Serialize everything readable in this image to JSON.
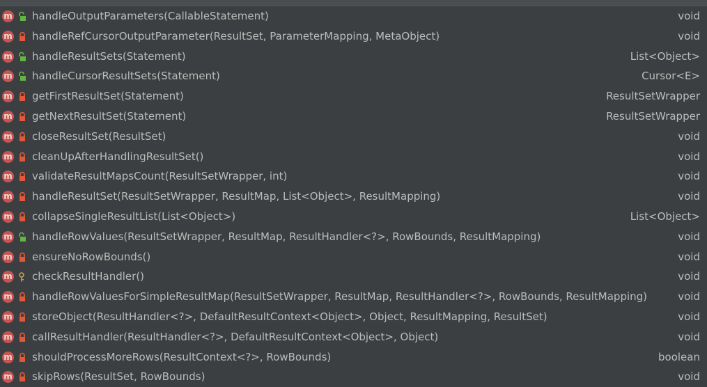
{
  "members": [
    {
      "signature": "handleOutputParameters(CallableStatement)",
      "return_type": "void",
      "visibility": "public-icon"
    },
    {
      "signature": "handleRefCursorOutputParameter(ResultSet, ParameterMapping, MetaObject)",
      "return_type": "void",
      "visibility": "private-icon"
    },
    {
      "signature": "handleResultSets(Statement)",
      "return_type": "List<Object>",
      "visibility": "public-icon"
    },
    {
      "signature": "handleCursorResultSets(Statement)",
      "return_type": "Cursor<E>",
      "visibility": "public-icon"
    },
    {
      "signature": "getFirstResultSet(Statement)",
      "return_type": "ResultSetWrapper",
      "visibility": "private-icon"
    },
    {
      "signature": "getNextResultSet(Statement)",
      "return_type": "ResultSetWrapper",
      "visibility": "private-icon"
    },
    {
      "signature": "closeResultSet(ResultSet)",
      "return_type": "void",
      "visibility": "private-icon"
    },
    {
      "signature": "cleanUpAfterHandlingResultSet()",
      "return_type": "void",
      "visibility": "private-icon"
    },
    {
      "signature": "validateResultMapsCount(ResultSetWrapper, int)",
      "return_type": "void",
      "visibility": "private-icon"
    },
    {
      "signature": "handleResultSet(ResultSetWrapper, ResultMap, List<Object>, ResultMapping)",
      "return_type": "void",
      "visibility": "private-icon"
    },
    {
      "signature": "collapseSingleResultList(List<Object>)",
      "return_type": "List<Object>",
      "visibility": "private-icon"
    },
    {
      "signature": "handleRowValues(ResultSetWrapper, ResultMap, ResultHandler<?>, RowBounds, ResultMapping)",
      "return_type": "void",
      "visibility": "public-icon"
    },
    {
      "signature": "ensureNoRowBounds()",
      "return_type": "void",
      "visibility": "private-icon"
    },
    {
      "signature": "checkResultHandler()",
      "return_type": "void",
      "visibility": "protected-icon"
    },
    {
      "signature": "handleRowValuesForSimpleResultMap(ResultSetWrapper, ResultMap, ResultHandler<?>, RowBounds, ResultMapping)",
      "return_type": "void",
      "visibility": "private-icon"
    },
    {
      "signature": "storeObject(ResultHandler<?>, DefaultResultContext<Object>, Object, ResultMapping, ResultSet)",
      "return_type": "void",
      "visibility": "private-icon"
    },
    {
      "signature": "callResultHandler(ResultHandler<?>, DefaultResultContext<Object>, Object)",
      "return_type": "void",
      "visibility": "private-icon"
    },
    {
      "signature": "shouldProcessMoreRows(ResultContext<?>, RowBounds)",
      "return_type": "boolean",
      "visibility": "private-icon"
    },
    {
      "signature": "skipRows(ResultSet, RowBounds)",
      "return_type": "void",
      "visibility": "private-icon"
    }
  ],
  "method_icon_letter": "m",
  "colors": {
    "background": "#3c3f41",
    "method_icon": "#c75450",
    "public": "#62b543",
    "private": "#e05a3a",
    "protected": "#c9a14b",
    "text": "#bbbbbb"
  }
}
